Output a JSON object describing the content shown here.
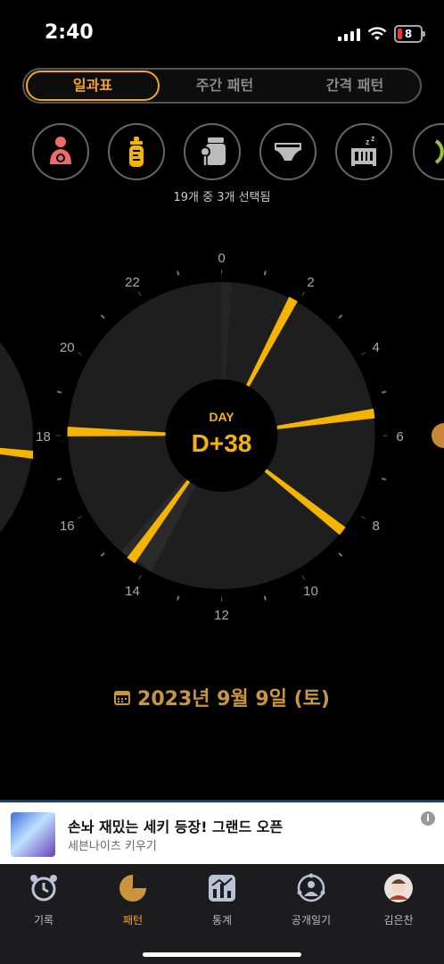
{
  "status": {
    "time": "2:40",
    "battery": "8"
  },
  "tabs": [
    {
      "label": "일과표",
      "active": true
    },
    {
      "label": "주간 패턴",
      "active": false
    },
    {
      "label": "간격 패턴",
      "active": false
    }
  ],
  "category_icons": [
    "breastfeeding-icon",
    "bottle-icon",
    "baby-food-icon",
    "diaper-icon",
    "sleep-crib-icon",
    "more-icon"
  ],
  "selection_text": "19개 중 3개 선택됨",
  "dial": {
    "hour_labels": [
      "0",
      "2",
      "4",
      "6",
      "8",
      "10",
      "12",
      "14",
      "16",
      "18",
      "20",
      "22"
    ],
    "day_label": "DAY",
    "day_value": "D+38",
    "accent": "#f5b400",
    "events_hours": [
      1.85,
      5.45,
      8.55,
      14.4,
      18.1
    ]
  },
  "date": "2023년 9월 9일 (토)",
  "ad": {
    "title": "손놔 재밌는 세키 등장! 그랜드 오픈",
    "subtitle": "세븐나이츠 키우기",
    "info": "i"
  },
  "nav": [
    {
      "label": "기록",
      "icon": "alarm-clock-icon",
      "active": false
    },
    {
      "label": "패턴",
      "icon": "pattern-chart-icon",
      "active": true
    },
    {
      "label": "통계",
      "icon": "stats-chart-icon",
      "active": false
    },
    {
      "label": "공개일기",
      "icon": "public-diary-icon",
      "active": false
    },
    {
      "label": "김은찬",
      "icon": "profile-avatar-icon",
      "active": false
    }
  ]
}
